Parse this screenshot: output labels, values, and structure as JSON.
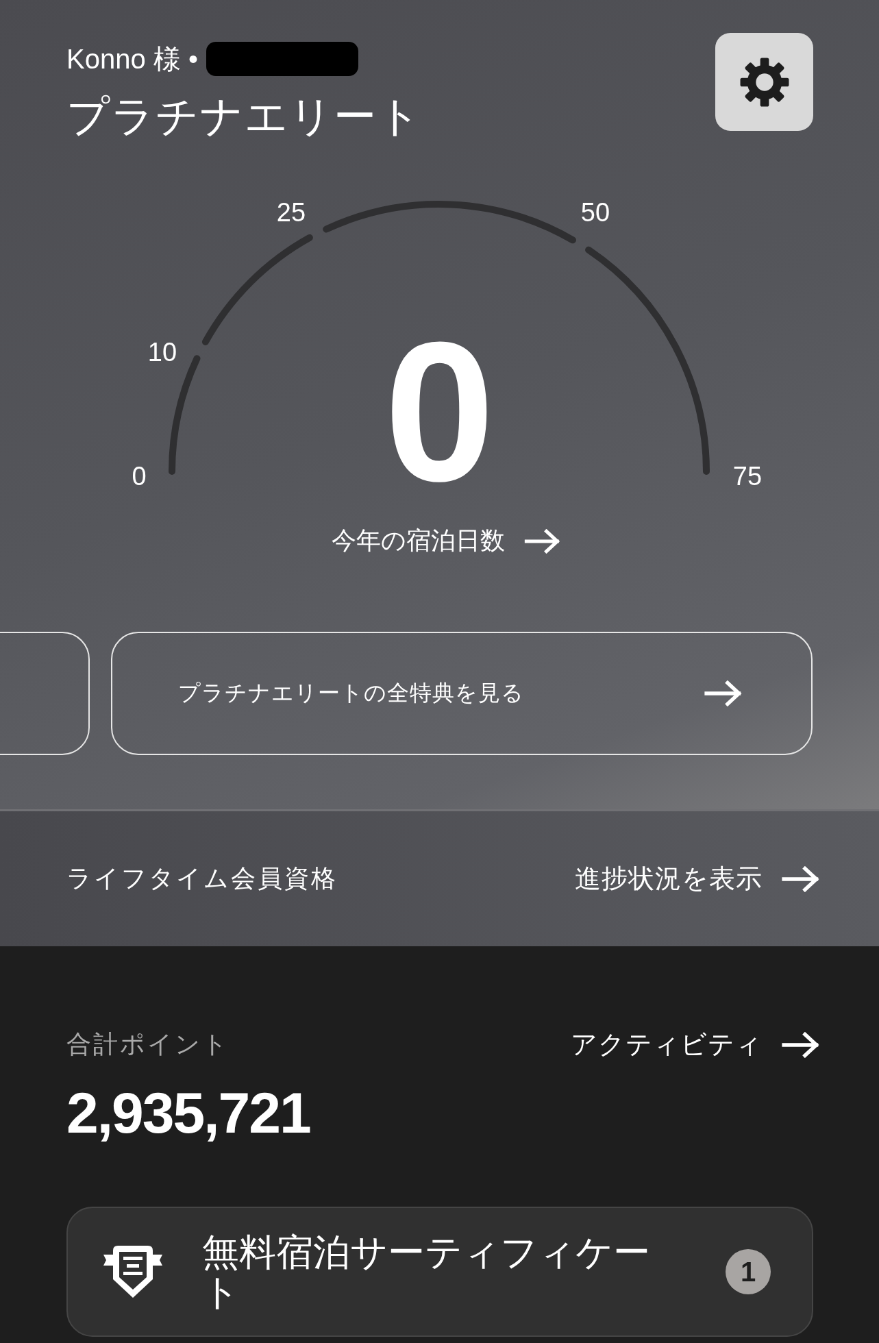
{
  "header": {
    "greeting": "Konno 様 •",
    "tier": "プラチナエリート"
  },
  "gauge": {
    "ticks": [
      "0",
      "10",
      "25",
      "50",
      "75"
    ],
    "value": "0",
    "caption": "今年の宿泊日数"
  },
  "benefits_link": {
    "label": "プラチナエリートの全特典を見る"
  },
  "lifetime": {
    "label": "ライフタイム会員資格",
    "link": "進捗状況を表示"
  },
  "points": {
    "label": "合計ポイント",
    "link": "アクティビティ",
    "total": "2,935,721"
  },
  "certificates": [
    {
      "label": "無料宿泊サーティフィケート",
      "count": "1"
    }
  ]
}
